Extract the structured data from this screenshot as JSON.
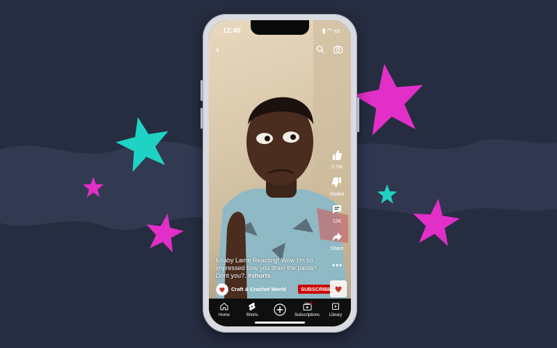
{
  "colors": {
    "background": "#262d40",
    "wave": "#323a52",
    "star_teal": "#1fd3c4",
    "star_pink": "#e12fc8",
    "subscribe": "#cc0000"
  },
  "status_bar": {
    "time": "12:40"
  },
  "icons": [
    "back-icon",
    "search-icon",
    "camera-icon",
    "like-icon",
    "dislike-icon",
    "comments-icon",
    "share-icon",
    "more-icon",
    "home-icon",
    "shorts-icon",
    "create-icon",
    "subscriptions-icon",
    "library-icon"
  ],
  "actions": {
    "likes": "2.7M",
    "dislike": "Dislike",
    "comments": "12K",
    "share": "Share"
  },
  "caption": {
    "text": "Khaby Lame Reacting! Wow I'm so impressed how you drain the pasta!! Dont you?..",
    "hashtag": "#shorts"
  },
  "channel": {
    "name": "Craft & Crochet World",
    "subscribe_label": "SUBSCRIBE"
  },
  "nav": {
    "home": "Home",
    "shorts": "Shorts",
    "subscriptions": "Subscriptions",
    "library": "Library"
  }
}
